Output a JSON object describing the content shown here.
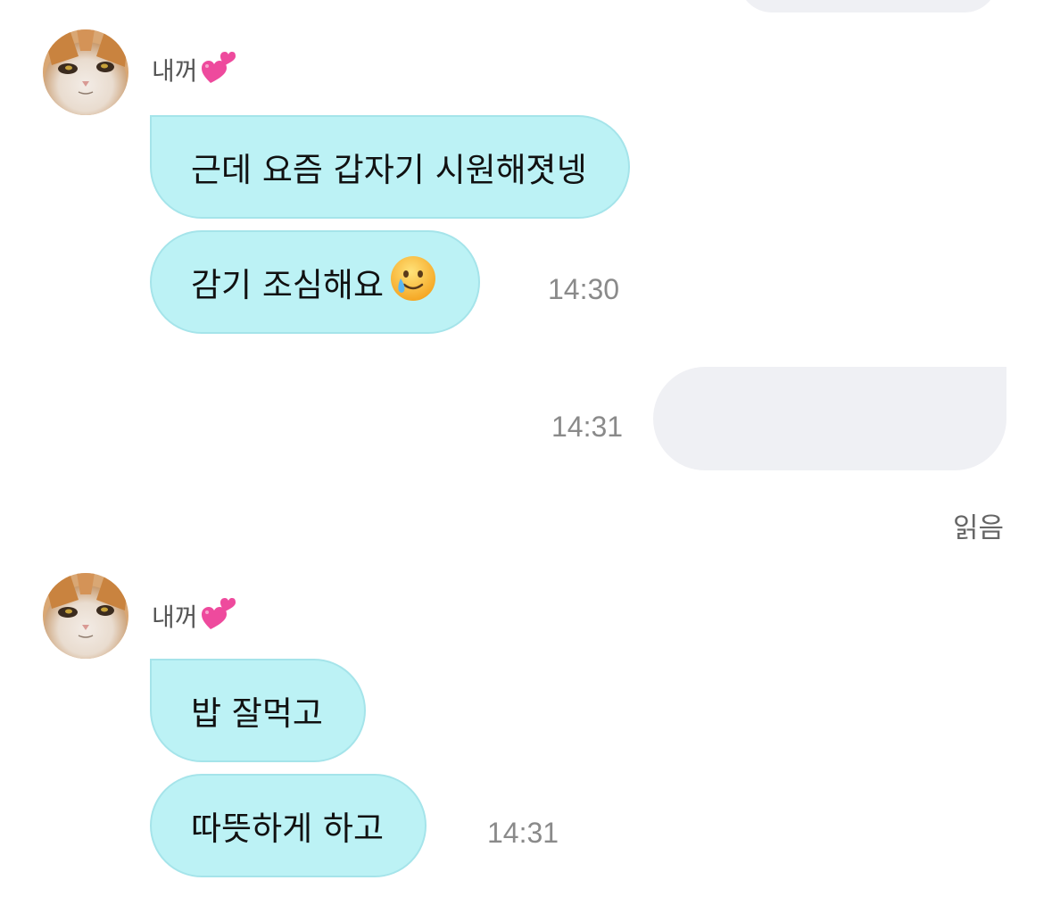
{
  "colors": {
    "incoming_bubble": "#bcf2f5",
    "incoming_border": "#a5e4ea",
    "outgoing_bubble": "#eff0f4",
    "timestamp": "#8a8a8a"
  },
  "groups": [
    {
      "sender": "내꺼",
      "sender_icon": "heart-icon",
      "avatar_icon": "cat-avatar-icon",
      "messages": [
        {
          "text": "근데 요즘 갑자기 시원해졋넹"
        },
        {
          "text": "감기 조심해요",
          "emoji": "🥲",
          "emoji_icon": "smiling-face-with-tear-icon",
          "time": "14:30"
        }
      ]
    },
    {
      "outgoing": true,
      "time": "14:31",
      "text": "",
      "read_label": "읽음"
    },
    {
      "sender": "내꺼",
      "sender_icon": "heart-icon",
      "avatar_icon": "cat-avatar-icon",
      "messages": [
        {
          "text": "밥 잘먹고"
        },
        {
          "text": "따뜻하게 하고",
          "time": "14:31"
        }
      ]
    }
  ]
}
